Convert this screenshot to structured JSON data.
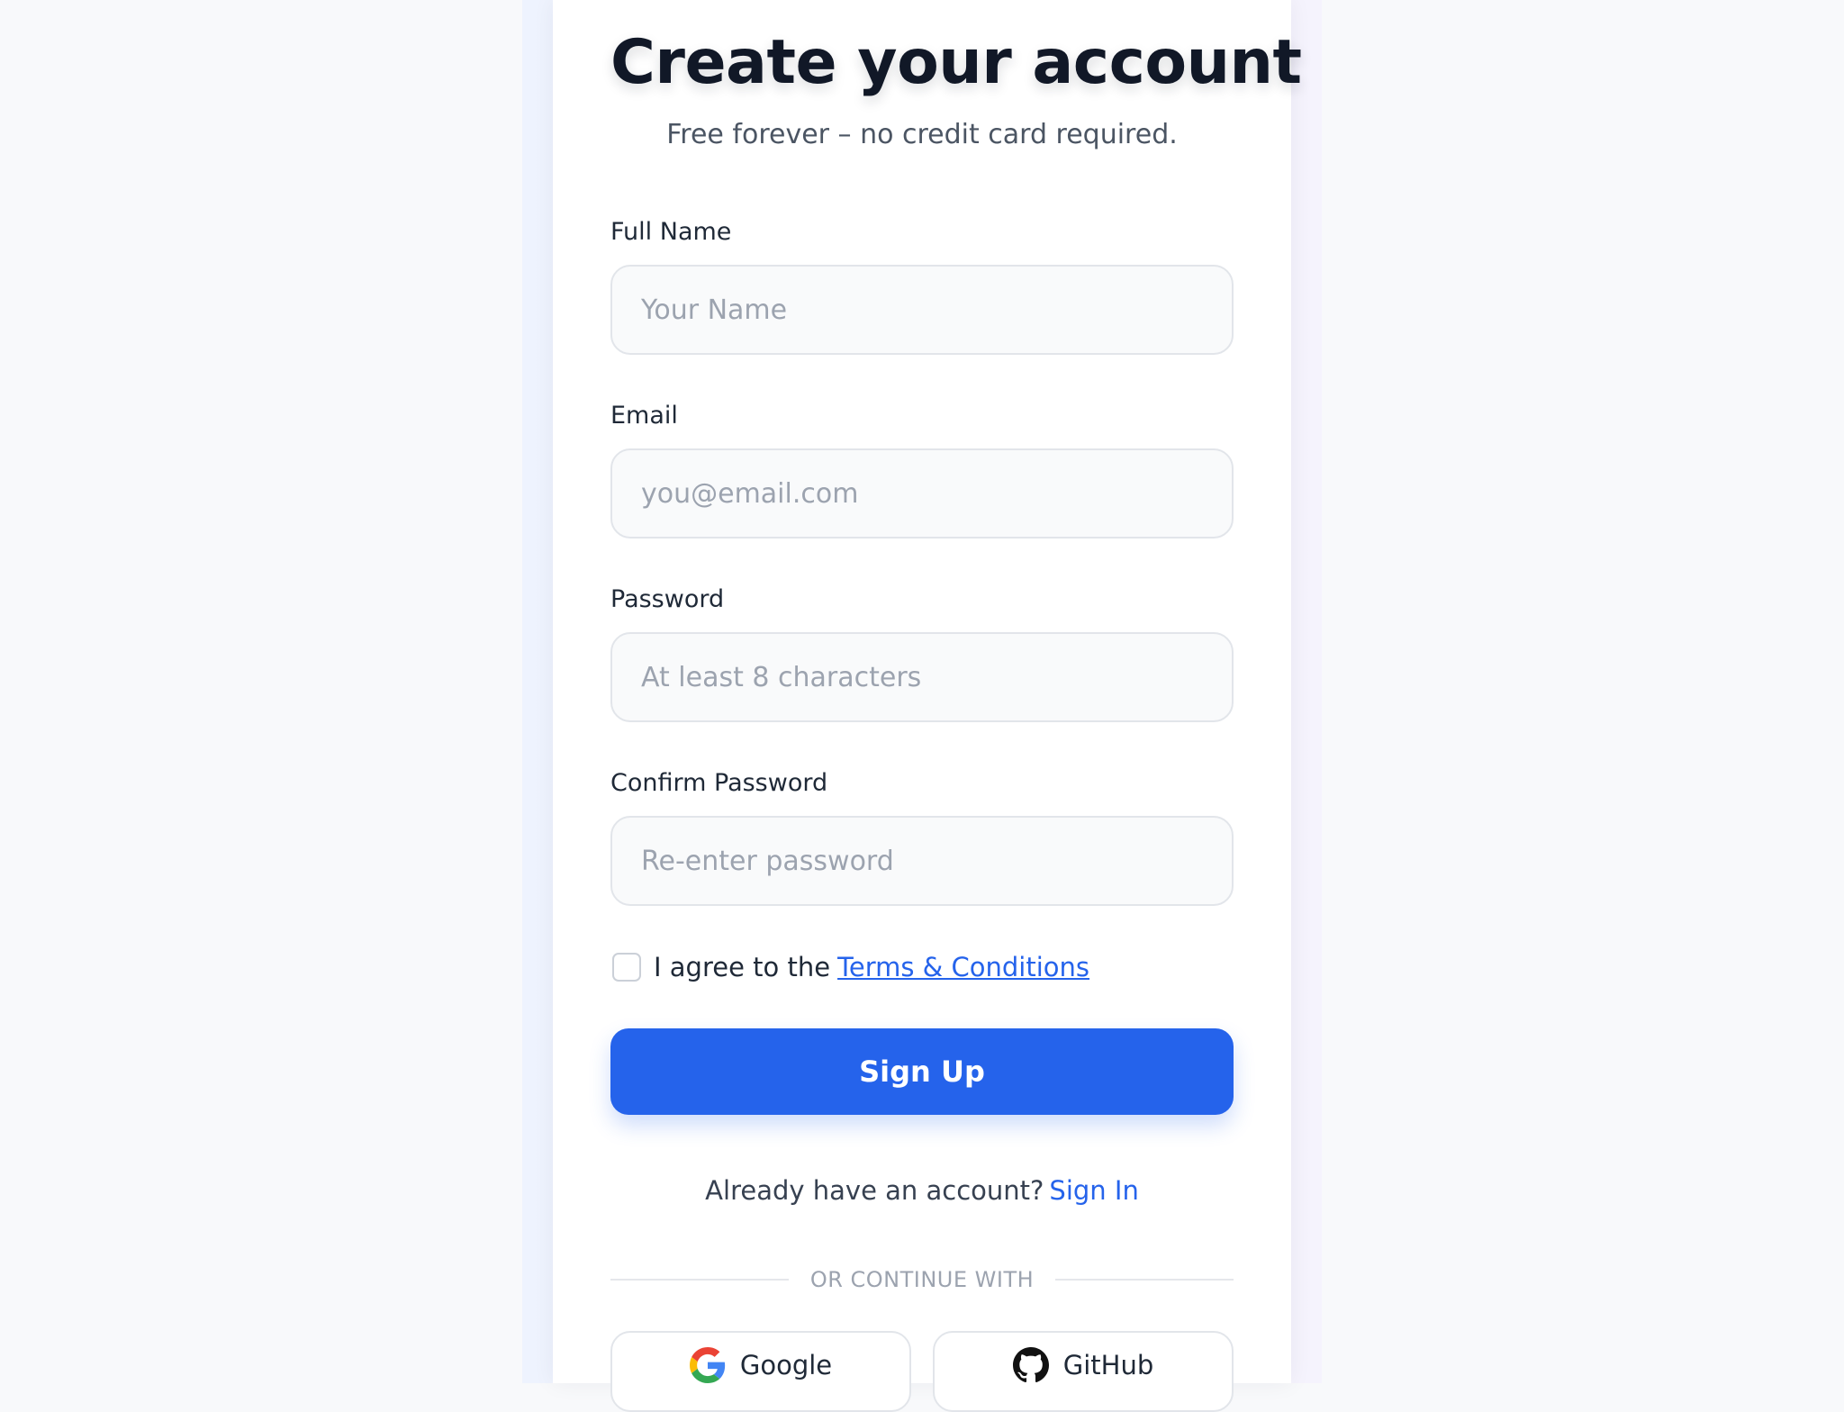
{
  "header": {
    "title": "Create your account",
    "subtitle": "Free forever – no credit card required."
  },
  "form": {
    "full_name": {
      "label": "Full Name",
      "placeholder": "Your Name",
      "value": ""
    },
    "email": {
      "label": "Email",
      "placeholder": "you@email.com",
      "value": ""
    },
    "password": {
      "label": "Password",
      "placeholder": "At least 8 characters",
      "value": ""
    },
    "confirm_password": {
      "label": "Confirm Password",
      "placeholder": "Re-enter password",
      "value": ""
    },
    "terms": {
      "checked": false,
      "text": "I agree to the",
      "link_label": "Terms & Conditions"
    },
    "submit_label": "Sign Up"
  },
  "signin": {
    "text": "Already have an account?",
    "link_label": "Sign In"
  },
  "social": {
    "divider_label": "OR CONTINUE WITH",
    "buttons": [
      {
        "label": "Google",
        "icon": "google-icon"
      },
      {
        "label": "GitHub",
        "icon": "github-icon"
      }
    ]
  },
  "colors": {
    "accent": "#2563eb",
    "title": "#111827",
    "page_background": "#f8f9fb",
    "card_background": "#ffffff"
  }
}
